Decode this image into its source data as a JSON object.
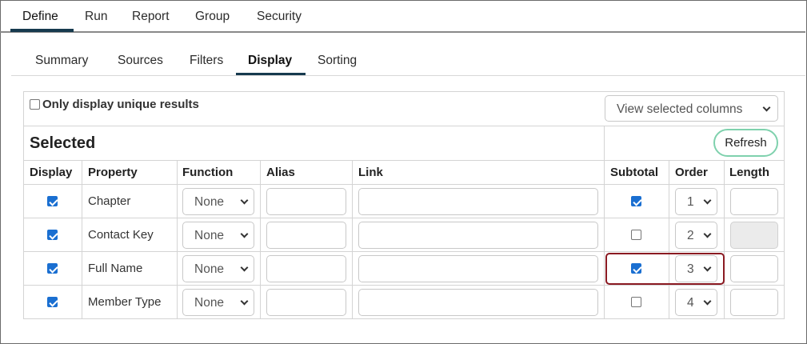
{
  "top_tabs": [
    {
      "label": "Define",
      "active": true
    },
    {
      "label": "Run",
      "active": false
    },
    {
      "label": "Report",
      "active": false
    },
    {
      "label": "Group",
      "active": false
    },
    {
      "label": "Security",
      "active": false
    }
  ],
  "sub_tabs": [
    {
      "label": "Summary",
      "active": false
    },
    {
      "label": "Sources",
      "active": false
    },
    {
      "label": "Filters",
      "active": false
    },
    {
      "label": "Display",
      "active": true
    },
    {
      "label": "Sorting",
      "active": false
    }
  ],
  "options": {
    "unique_label": "Only display unique results",
    "unique_checked": false,
    "view_select_value": "View selected columns"
  },
  "selected": {
    "title": "Selected",
    "refresh_label": "Refresh"
  },
  "columns": [
    "Display",
    "Property",
    "Function",
    "Alias",
    "Link",
    "Subtotal",
    "Order",
    "Length"
  ],
  "rows": [
    {
      "display": true,
      "property": "Chapter",
      "function": "None",
      "alias": "",
      "link": "",
      "subtotal": true,
      "order": "1",
      "length": "",
      "length_disabled": false
    },
    {
      "display": true,
      "property": "Contact Key",
      "function": "None",
      "alias": "",
      "link": "",
      "subtotal": false,
      "order": "2",
      "length": "",
      "length_disabled": true
    },
    {
      "display": true,
      "property": "Full Name",
      "function": "None",
      "alias": "",
      "link": "",
      "subtotal": true,
      "order": "3",
      "length": "",
      "length_disabled": false
    },
    {
      "display": true,
      "property": "Member Type",
      "function": "None",
      "alias": "",
      "link": "",
      "subtotal": false,
      "order": "4",
      "length": "",
      "length_disabled": false
    }
  ],
  "colors": {
    "tab_underline": "#163a4e",
    "refresh_border": "#7fd1ad",
    "checkbox_checked": "#1a6fd1",
    "highlight_border": "#8b1a22"
  }
}
